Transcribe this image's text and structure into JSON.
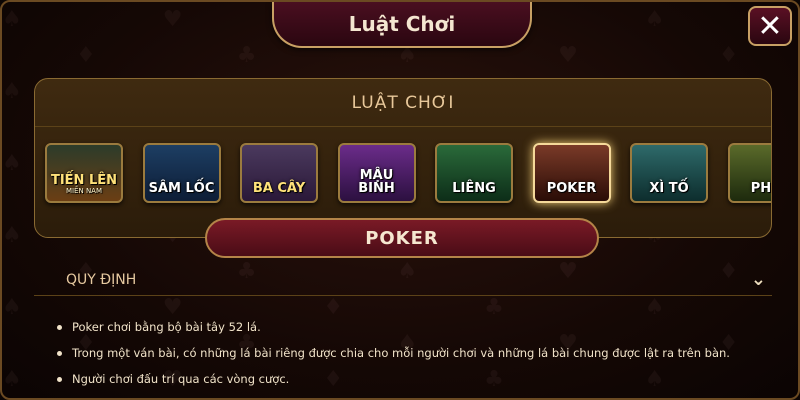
{
  "window": {
    "title": "Luật Chơi",
    "close_symbol": "✕"
  },
  "games": {
    "header": "LUẬT CHƠI",
    "items": [
      {
        "name": "TIẾN LÊN",
        "sub": "MIỀN NAM",
        "color_top": "#2c3c2a",
        "color_bottom": "#6b3e14",
        "text_color": "#ffe27a"
      },
      {
        "name": "SÂM LỐC",
        "sub": "",
        "color_top": "#1d3e63",
        "color_bottom": "#0d1d36",
        "text_color": "#ffffff"
      },
      {
        "name": "BA CÂY",
        "sub": "",
        "color_top": "#4b3a5e",
        "color_bottom": "#2a1838",
        "text_color": "#ffe27a"
      },
      {
        "name": "MẬU BINH",
        "sub": "",
        "color_top": "#6b2c8a",
        "color_bottom": "#2c1040",
        "text_color": "#ffffff"
      },
      {
        "name": "LIÊNG",
        "sub": "",
        "color_top": "#2a6a3a",
        "color_bottom": "#0d2d18",
        "text_color": "#ffffff"
      },
      {
        "name": "POKER",
        "sub": "",
        "color_top": "#7a3a28",
        "color_bottom": "#2a0c06",
        "text_color": "#ffffff"
      },
      {
        "name": "XÌ TỐ",
        "sub": "",
        "color_top": "#2e6a6a",
        "color_bottom": "#0d2d2d",
        "text_color": "#ffffff"
      },
      {
        "name": "PHỎ",
        "sub": "",
        "color_top": "#5a6a2a",
        "color_bottom": "#1d2a0d",
        "text_color": "#ffffff"
      }
    ],
    "selected_index": 5
  },
  "current_game": "POKER",
  "section": {
    "title": "QUY ĐỊNH",
    "chevron": "⌄"
  },
  "rules": [
    "Poker chơi bằng bộ bài tây 52 lá.",
    "Trong một ván bài, có những lá bài riêng được chia cho mỗi người chơi và những lá bài chung được lật ra trên bàn.",
    "Người chơi đấu trí qua các vòng cược."
  ]
}
